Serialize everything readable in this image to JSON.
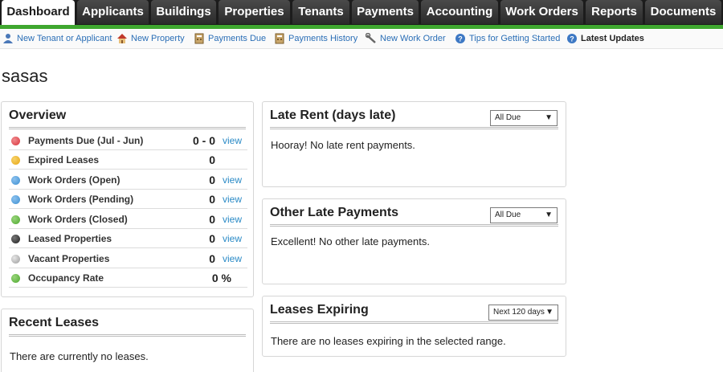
{
  "nav": {
    "tabs": [
      {
        "label": "Dashboard"
      },
      {
        "label": "Applicants"
      },
      {
        "label": "Buildings"
      },
      {
        "label": "Properties"
      },
      {
        "label": "Tenants"
      },
      {
        "label": "Payments"
      },
      {
        "label": "Accounting"
      },
      {
        "label": "Work Orders"
      },
      {
        "label": "Reports"
      },
      {
        "label": "Documents"
      }
    ],
    "active_tab": "Dashboard",
    "accent_color": "#3fa72f"
  },
  "quicklinks": [
    {
      "label": "New Tenant or Applicant",
      "icon": "user-icon"
    },
    {
      "label": "New Property",
      "icon": "house-icon"
    },
    {
      "label": "Payments Due",
      "icon": "calculator-icon"
    },
    {
      "label": "Payments History",
      "icon": "calculator-icon"
    },
    {
      "label": "New Work Order",
      "icon": "wrench-icon"
    },
    {
      "label": "Tips for Getting Started",
      "icon": "help-icon"
    },
    {
      "label": "Latest Updates",
      "icon": "help-icon"
    }
  ],
  "page": {
    "title": "sasas"
  },
  "overview": {
    "title": "Overview",
    "rows": [
      {
        "label": "Payments Due (Jul - Jun)",
        "value": "0 - 0",
        "link": "view",
        "dot_color": "#d9343b"
      },
      {
        "label": "Expired Leases",
        "value": "0",
        "link": "",
        "dot_color": "#e6a612"
      },
      {
        "label": "Work Orders (Open)",
        "value": "0",
        "link": "view",
        "dot_color": "#3d8fd1"
      },
      {
        "label": "Work Orders (Pending)",
        "value": "0",
        "link": "view",
        "dot_color": "#3d8fd1"
      },
      {
        "label": "Work Orders (Closed)",
        "value": "0",
        "link": "view",
        "dot_color": "#4ca82d"
      },
      {
        "label": "Leased Properties",
        "value": "0",
        "link": "view",
        "dot_color": "#2b2b2b"
      },
      {
        "label": "Vacant Properties",
        "value": "0",
        "link": "view",
        "dot_color": "#a9a9a9"
      },
      {
        "label": "Occupancy Rate",
        "value": "0 %",
        "link": "",
        "dot_color": "#4ca82d"
      }
    ]
  },
  "recent_leases": {
    "title": "Recent Leases",
    "message": "There are currently no leases."
  },
  "late_rent": {
    "title": "Late Rent (days late)",
    "filter": "All Due",
    "message": "Hooray! No late rent payments."
  },
  "other_late": {
    "title": "Other Late Payments",
    "filter": "All Due",
    "message": "Excellent! No other late payments."
  },
  "leases_expiring": {
    "title": "Leases Expiring",
    "filter": "Next 120 days",
    "message": "There are no leases expiring in the selected range."
  }
}
